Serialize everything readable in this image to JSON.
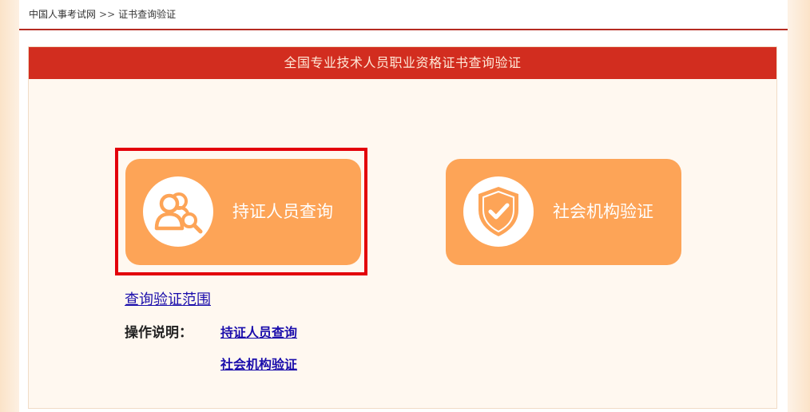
{
  "breadcrumb": {
    "home": "中国人事考试网",
    "separator": ">>",
    "current": "证书查询验证"
  },
  "panel": {
    "title": "全国专业技术人员职业资格证书查询验证"
  },
  "tiles": [
    {
      "label": "持证人员查询",
      "icon": "person-search-icon",
      "highlighted": true
    },
    {
      "label": "社会机构验证",
      "icon": "shield-check-icon",
      "highlighted": false
    }
  ],
  "links": {
    "scope": "查询验证范围",
    "ops_label": "操作说明：",
    "ops_items": [
      "持证人员查询",
      "社会机构验证"
    ]
  },
  "colors": {
    "header_red": "#d22d1f",
    "tile_orange": "#fda457",
    "highlight_red": "#e3000b",
    "link_blue": "#1a0dab"
  }
}
